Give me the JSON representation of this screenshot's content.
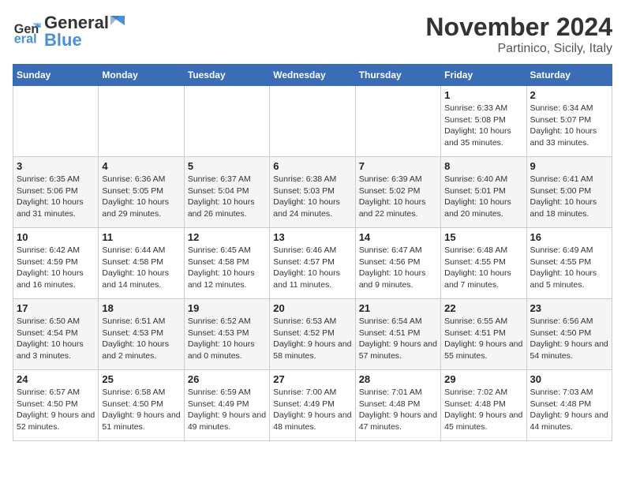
{
  "header": {
    "logo_line1": "General",
    "logo_line2": "Blue",
    "month_title": "November 2024",
    "location": "Partinico, Sicily, Italy"
  },
  "weekdays": [
    "Sunday",
    "Monday",
    "Tuesday",
    "Wednesday",
    "Thursday",
    "Friday",
    "Saturday"
  ],
  "weeks": [
    [
      {
        "day": "",
        "info": ""
      },
      {
        "day": "",
        "info": ""
      },
      {
        "day": "",
        "info": ""
      },
      {
        "day": "",
        "info": ""
      },
      {
        "day": "",
        "info": ""
      },
      {
        "day": "1",
        "info": "Sunrise: 6:33 AM\nSunset: 5:08 PM\nDaylight: 10 hours and 35 minutes."
      },
      {
        "day": "2",
        "info": "Sunrise: 6:34 AM\nSunset: 5:07 PM\nDaylight: 10 hours and 33 minutes."
      }
    ],
    [
      {
        "day": "3",
        "info": "Sunrise: 6:35 AM\nSunset: 5:06 PM\nDaylight: 10 hours and 31 minutes."
      },
      {
        "day": "4",
        "info": "Sunrise: 6:36 AM\nSunset: 5:05 PM\nDaylight: 10 hours and 29 minutes."
      },
      {
        "day": "5",
        "info": "Sunrise: 6:37 AM\nSunset: 5:04 PM\nDaylight: 10 hours and 26 minutes."
      },
      {
        "day": "6",
        "info": "Sunrise: 6:38 AM\nSunset: 5:03 PM\nDaylight: 10 hours and 24 minutes."
      },
      {
        "day": "7",
        "info": "Sunrise: 6:39 AM\nSunset: 5:02 PM\nDaylight: 10 hours and 22 minutes."
      },
      {
        "day": "8",
        "info": "Sunrise: 6:40 AM\nSunset: 5:01 PM\nDaylight: 10 hours and 20 minutes."
      },
      {
        "day": "9",
        "info": "Sunrise: 6:41 AM\nSunset: 5:00 PM\nDaylight: 10 hours and 18 minutes."
      }
    ],
    [
      {
        "day": "10",
        "info": "Sunrise: 6:42 AM\nSunset: 4:59 PM\nDaylight: 10 hours and 16 minutes."
      },
      {
        "day": "11",
        "info": "Sunrise: 6:44 AM\nSunset: 4:58 PM\nDaylight: 10 hours and 14 minutes."
      },
      {
        "day": "12",
        "info": "Sunrise: 6:45 AM\nSunset: 4:58 PM\nDaylight: 10 hours and 12 minutes."
      },
      {
        "day": "13",
        "info": "Sunrise: 6:46 AM\nSunset: 4:57 PM\nDaylight: 10 hours and 11 minutes."
      },
      {
        "day": "14",
        "info": "Sunrise: 6:47 AM\nSunset: 4:56 PM\nDaylight: 10 hours and 9 minutes."
      },
      {
        "day": "15",
        "info": "Sunrise: 6:48 AM\nSunset: 4:55 PM\nDaylight: 10 hours and 7 minutes."
      },
      {
        "day": "16",
        "info": "Sunrise: 6:49 AM\nSunset: 4:55 PM\nDaylight: 10 hours and 5 minutes."
      }
    ],
    [
      {
        "day": "17",
        "info": "Sunrise: 6:50 AM\nSunset: 4:54 PM\nDaylight: 10 hours and 3 minutes."
      },
      {
        "day": "18",
        "info": "Sunrise: 6:51 AM\nSunset: 4:53 PM\nDaylight: 10 hours and 2 minutes."
      },
      {
        "day": "19",
        "info": "Sunrise: 6:52 AM\nSunset: 4:53 PM\nDaylight: 10 hours and 0 minutes."
      },
      {
        "day": "20",
        "info": "Sunrise: 6:53 AM\nSunset: 4:52 PM\nDaylight: 9 hours and 58 minutes."
      },
      {
        "day": "21",
        "info": "Sunrise: 6:54 AM\nSunset: 4:51 PM\nDaylight: 9 hours and 57 minutes."
      },
      {
        "day": "22",
        "info": "Sunrise: 6:55 AM\nSunset: 4:51 PM\nDaylight: 9 hours and 55 minutes."
      },
      {
        "day": "23",
        "info": "Sunrise: 6:56 AM\nSunset: 4:50 PM\nDaylight: 9 hours and 54 minutes."
      }
    ],
    [
      {
        "day": "24",
        "info": "Sunrise: 6:57 AM\nSunset: 4:50 PM\nDaylight: 9 hours and 52 minutes."
      },
      {
        "day": "25",
        "info": "Sunrise: 6:58 AM\nSunset: 4:50 PM\nDaylight: 9 hours and 51 minutes."
      },
      {
        "day": "26",
        "info": "Sunrise: 6:59 AM\nSunset: 4:49 PM\nDaylight: 9 hours and 49 minutes."
      },
      {
        "day": "27",
        "info": "Sunrise: 7:00 AM\nSunset: 4:49 PM\nDaylight: 9 hours and 48 minutes."
      },
      {
        "day": "28",
        "info": "Sunrise: 7:01 AM\nSunset: 4:48 PM\nDaylight: 9 hours and 47 minutes."
      },
      {
        "day": "29",
        "info": "Sunrise: 7:02 AM\nSunset: 4:48 PM\nDaylight: 9 hours and 45 minutes."
      },
      {
        "day": "30",
        "info": "Sunrise: 7:03 AM\nSunset: 4:48 PM\nDaylight: 9 hours and 44 minutes."
      }
    ]
  ]
}
